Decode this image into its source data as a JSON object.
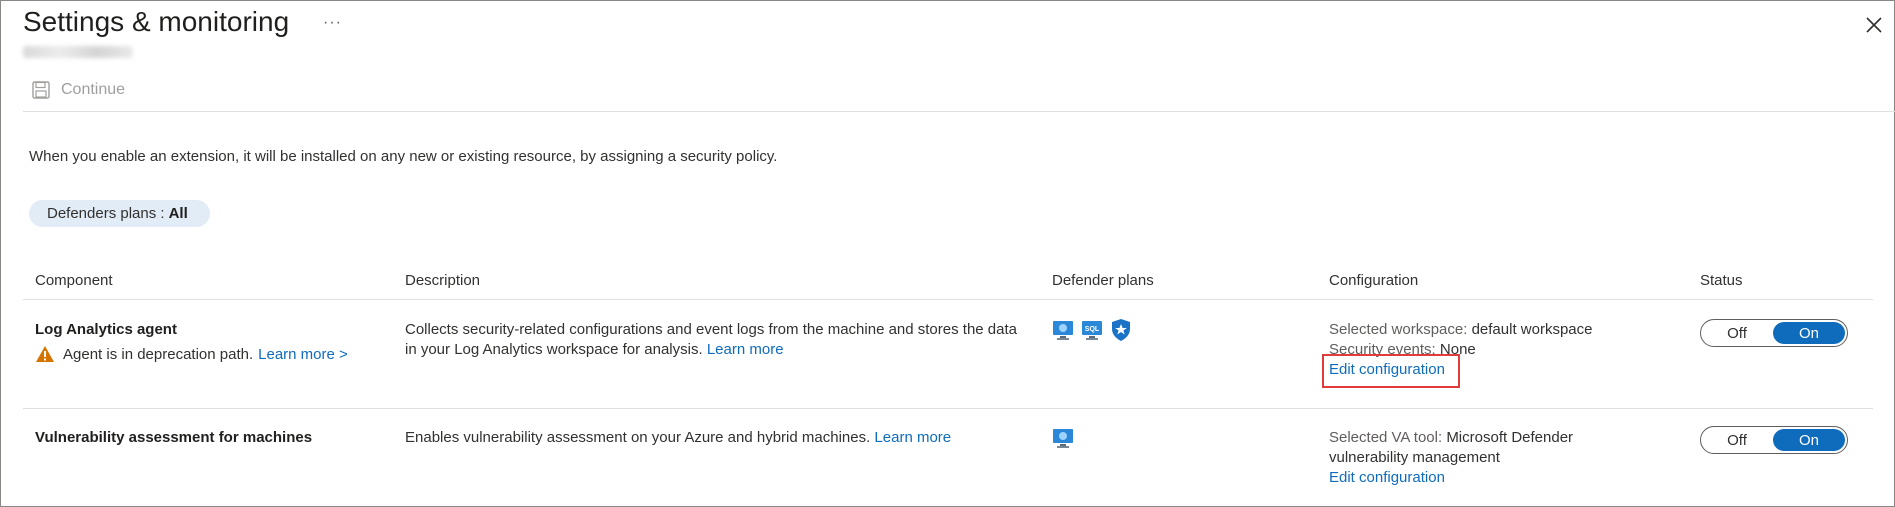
{
  "header": {
    "title": "Settings & monitoring",
    "more_label": "···"
  },
  "toolbar": {
    "continue_label": "Continue"
  },
  "intro_text": "When you enable an extension, it will be installed on any new or existing resource, by assigning a security policy.",
  "filter_pill": {
    "label": "Defenders plans :",
    "value": "All"
  },
  "table": {
    "headers": [
      "Component",
      "Description",
      "Defender plans",
      "Configuration",
      "Status"
    ],
    "rows": [
      {
        "component": "Log Analytics agent",
        "warning": "Agent is in deprecation path.",
        "warning_link": "Learn more >",
        "description": "Collects security-related configurations and event logs from the machine and stores the data in your Log Analytics workspace for analysis.",
        "description_link": "Learn more",
        "plans_icons": [
          "server-icon",
          "sql-icon",
          "shield-icon"
        ],
        "config_label_1": "Selected workspace:",
        "config_value_1": "default workspace",
        "config_label_2": "Security events:",
        "config_value_2": "None",
        "config_link": "Edit configuration",
        "toggle_off": "Off",
        "toggle_on": "On"
      },
      {
        "component": "Vulnerability assessment for machines",
        "description": "Enables vulnerability assessment on your Azure and hybrid machines.",
        "description_link": "Learn more",
        "plans_icons": [
          "server-icon"
        ],
        "config_label_1": "Selected VA tool:",
        "config_value_1": "Microsoft Defender vulnerability management",
        "config_link": "Edit configuration",
        "toggle_off": "Off",
        "toggle_on": "On"
      }
    ]
  },
  "colors": {
    "accent": "#0f6cbd",
    "highlight_border": "#e03c3c",
    "warning": "#d47500"
  }
}
